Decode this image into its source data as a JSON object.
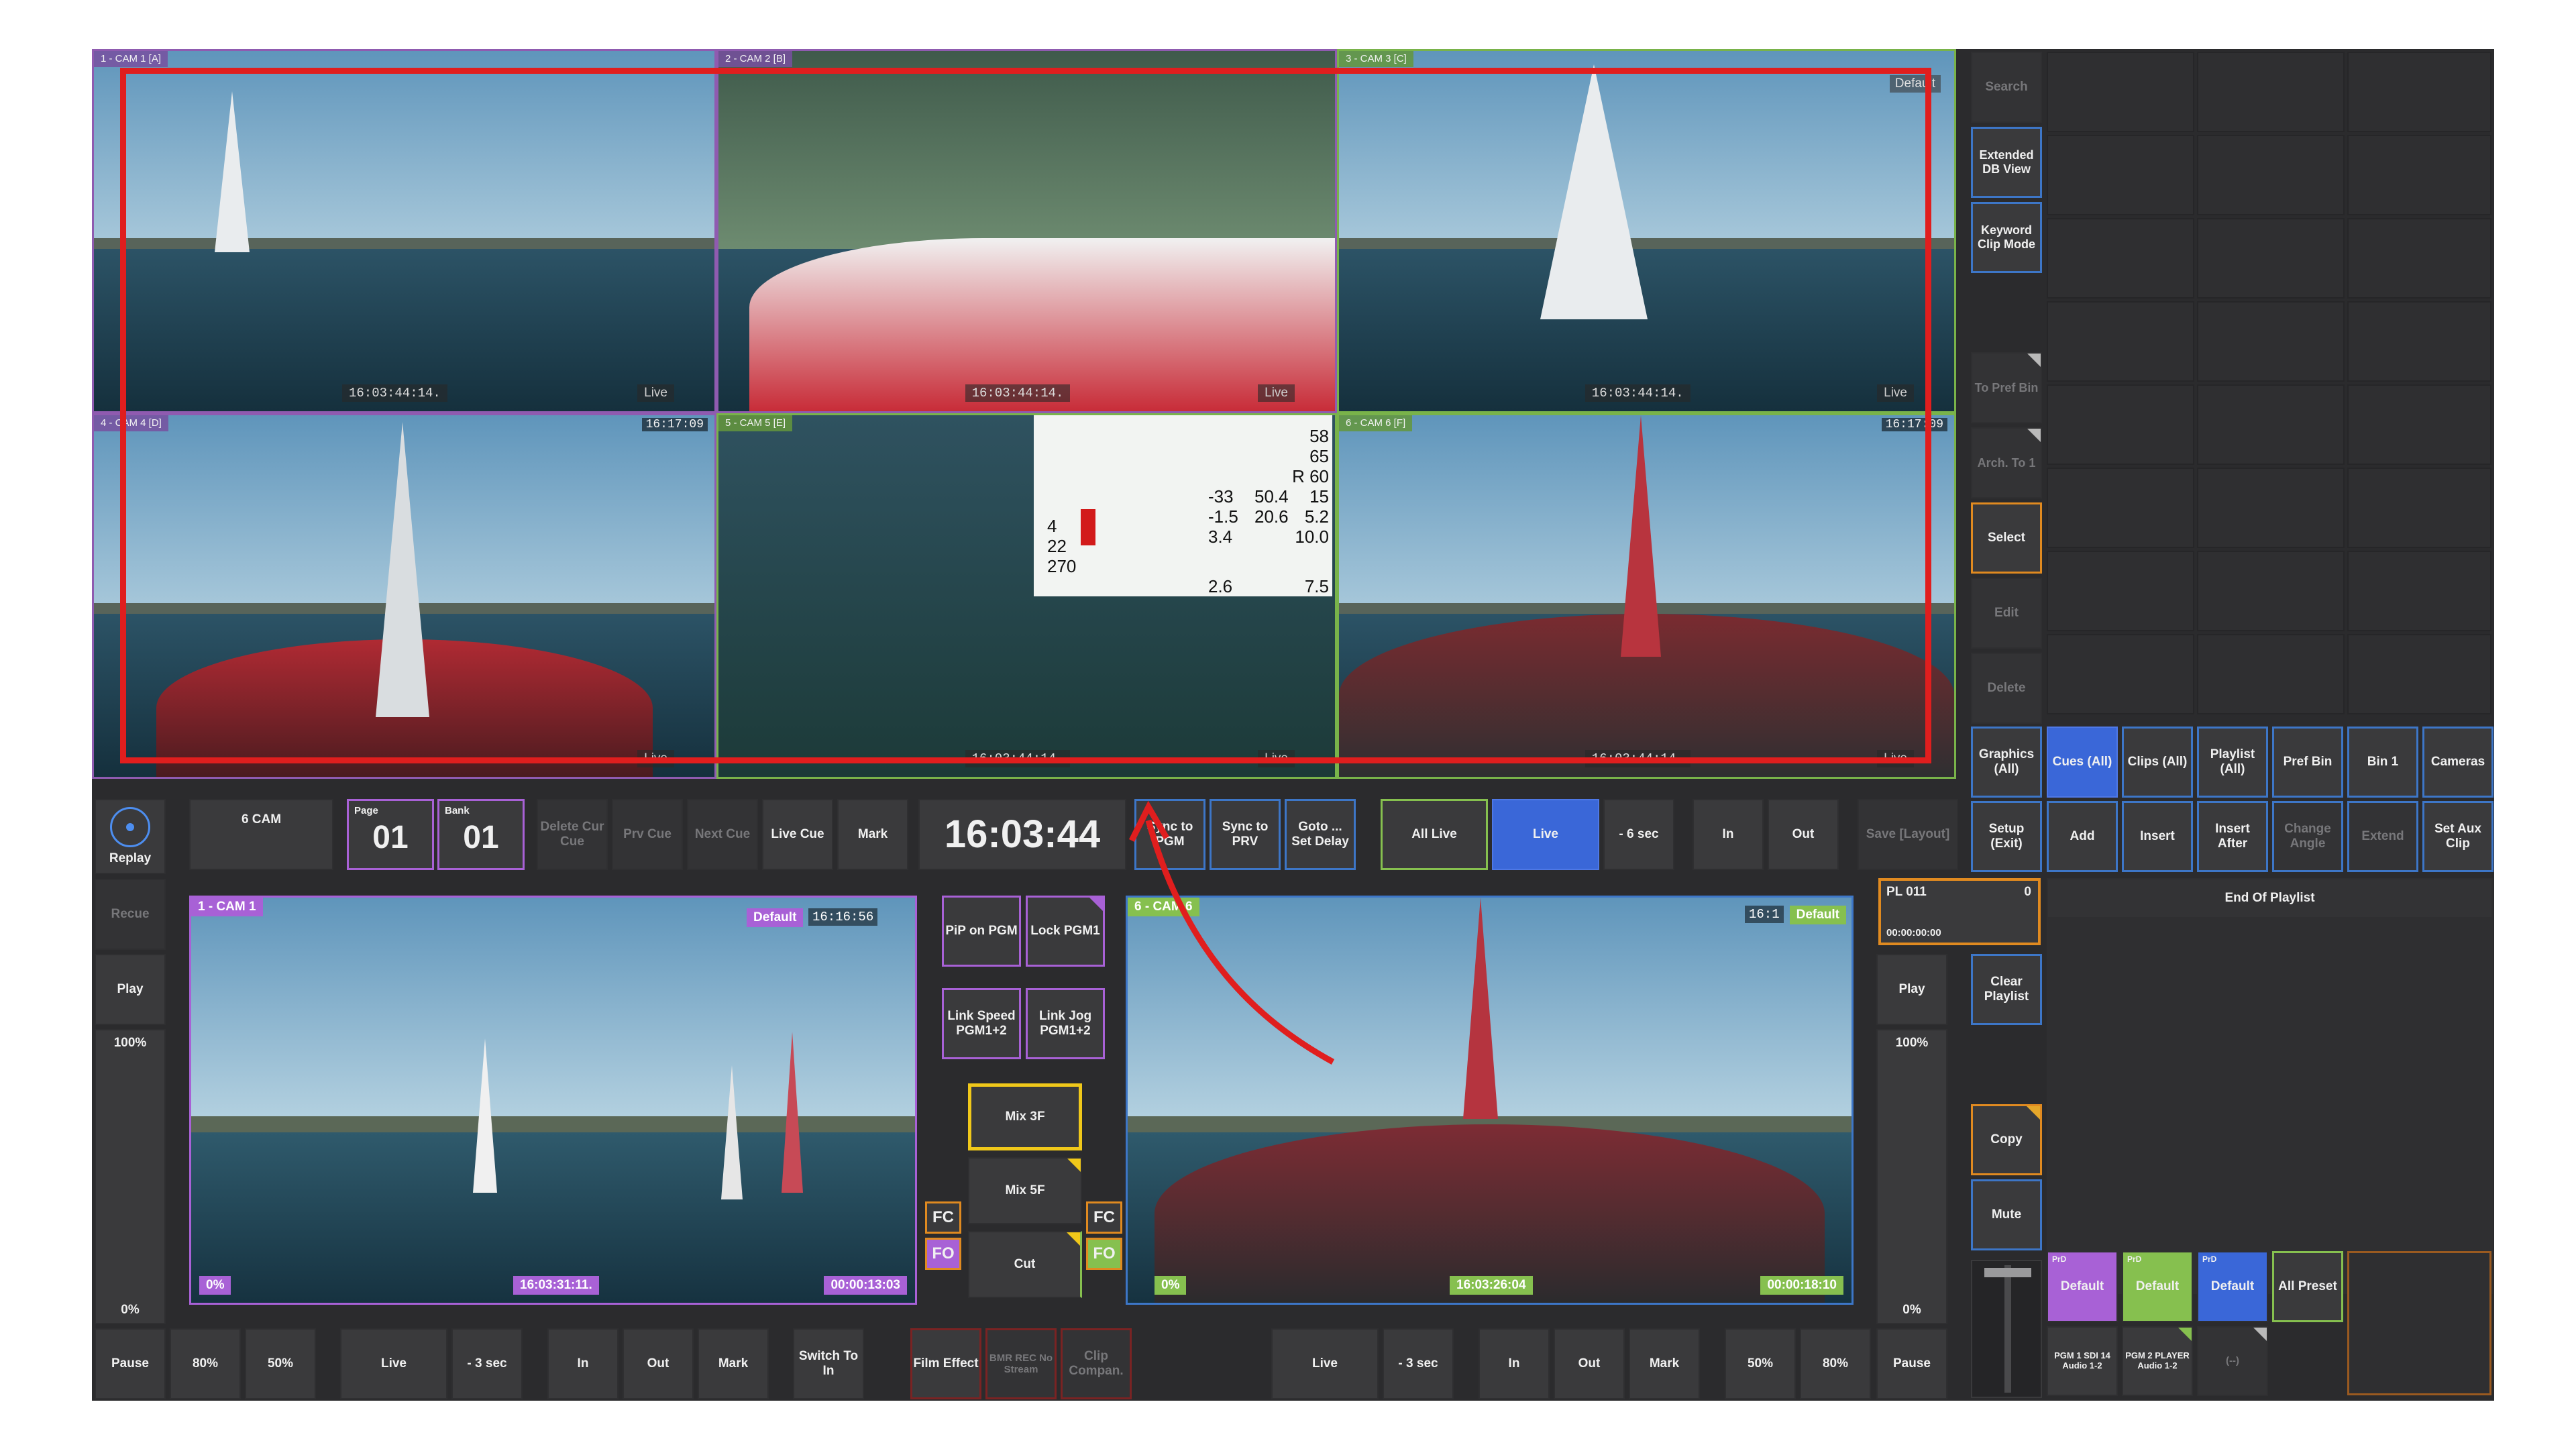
{
  "multiview": {
    "tiles": [
      {
        "label": "1 - CAM 1 [A]",
        "tc": "",
        "tc_bottom": "16:03:44:14.",
        "live": "Live",
        "extra": ""
      },
      {
        "label": "2 - CAM 2 [B]",
        "tc": "",
        "tc_bottom": "16:03:44:14.",
        "live": "Live",
        "extra": ""
      },
      {
        "label": "3 - CAM 3 [C]",
        "tc": "",
        "tc_bottom": "16:03:44:14.",
        "live": "Live",
        "extra": "Default"
      },
      {
        "label": "4 - CAM 4 [D]",
        "tc": "16:17:09",
        "tc_bottom": "",
        "live": "Live",
        "extra": ""
      },
      {
        "label": "5 - CAM 5 [E]",
        "tc": "",
        "tc_bottom": "16:03:44:14.",
        "live": "Live",
        "extra": ""
      },
      {
        "label": "6 - CAM 6 [F]",
        "tc": "16:17:09",
        "tc_bottom": "16:03:44:14.",
        "live": "Live",
        "extra": ""
      }
    ],
    "telemetry": {
      "values": [
        "58",
        "65",
        "R 60",
        "-33",
        "50.4",
        "15",
        "-1.5",
        "20.6",
        "5.2",
        "3.4",
        "10.0",
        "22",
        "270",
        "2.6",
        "7.5",
        "4"
      ]
    }
  },
  "side_column": {
    "buttons": [
      "Search",
      "Extended DB View",
      "Keyword Clip Mode",
      "To Pref Bin",
      "Arch. To 1",
      "Select",
      "Edit",
      "Delete"
    ]
  },
  "bins": [
    "Graphics (All)",
    "Cues (All)",
    "Clips (All)",
    "Playlist (All)",
    "Pref Bin",
    "Bin 1",
    "Cameras"
  ],
  "actions": [
    "Setup (Exit)",
    "Add",
    "Insert",
    "Insert After",
    "Change Angle",
    "Extend",
    "Set Aux Clip"
  ],
  "top_controls": {
    "replay": "Replay",
    "cam_count": "6 CAM",
    "page_label": "Page",
    "page_value": "01",
    "bank_label": "Bank",
    "bank_value": "01",
    "delete_cue": "Delete Cur Cue",
    "prv_cue": "Prv Cue",
    "next_cue": "Next Cue",
    "live_cue": "Live Cue",
    "mark": "Mark",
    "clock": "16:03:44",
    "sync_pgm": "Sync to PGM",
    "sync_prv": "Sync to PRV",
    "goto_delay": "Goto ... Set Delay",
    "all_live": "All Live",
    "live": "Live",
    "minus6": "- 6 sec",
    "in": "In",
    "out": "Out",
    "save_layout": "Save [Layout]"
  },
  "left_strip": {
    "recue": "Recue",
    "play": "Play",
    "pct_top": "100%",
    "pct_bottom": "0%"
  },
  "right_strip": {
    "play": "Play",
    "pct_top": "100%",
    "pct_bottom": "0%"
  },
  "pgm1": {
    "tag": "1 - CAM 1",
    "default": "Default",
    "tc_top": "16:16:56",
    "pct": "0%",
    "tc_mid": "16:03:31:11.",
    "tc_right": "00:00:13:03"
  },
  "pgm2": {
    "tag": "6 - CAM 6",
    "default": "Default",
    "tc_top": "16:1",
    "pct": "0%",
    "tc_mid": "16:03:26:04",
    "tc_right": "00:00:18:10"
  },
  "center_controls": {
    "pip": "PiP on PGM",
    "lock": "Lock PGM1",
    "link_speed": "Link Speed PGM1+2",
    "link_jog": "Link Jog PGM1+2",
    "mix3": "Mix 3F",
    "mix5": "Mix 5F",
    "cut": "Cut",
    "fc": "FC",
    "fo": "FO"
  },
  "playlist": {
    "name": "PL 011",
    "count": "0",
    "time": "00:00:00:00",
    "end": "End Of Playlist",
    "clear": "Clear Playlist",
    "copy": "Copy",
    "mute": "Mute"
  },
  "presets": {
    "items": [
      {
        "tag": "PrD",
        "label": "Default",
        "sub": "PGM 1 SDI 14 Audio 1-2"
      },
      {
        "tag": "PrD",
        "label": "Default",
        "sub": "PGM 2 PLAYER Audio 1-2"
      },
      {
        "tag": "PrD",
        "label": "Default",
        "sub": "(--)"
      }
    ],
    "all": "All Preset"
  },
  "bottom_left": [
    "Pause",
    "80%",
    "50%",
    "Live",
    "- 3 sec",
    "In",
    "Out",
    "Mark",
    "Switch To In"
  ],
  "bottom_center": [
    "Film Effect",
    "BMR REC No Stream",
    "Clip Compan."
  ],
  "bottom_right": [
    "Live",
    "- 3 sec",
    "In",
    "Out",
    "Mark",
    "50%",
    "80%",
    "Pause"
  ]
}
